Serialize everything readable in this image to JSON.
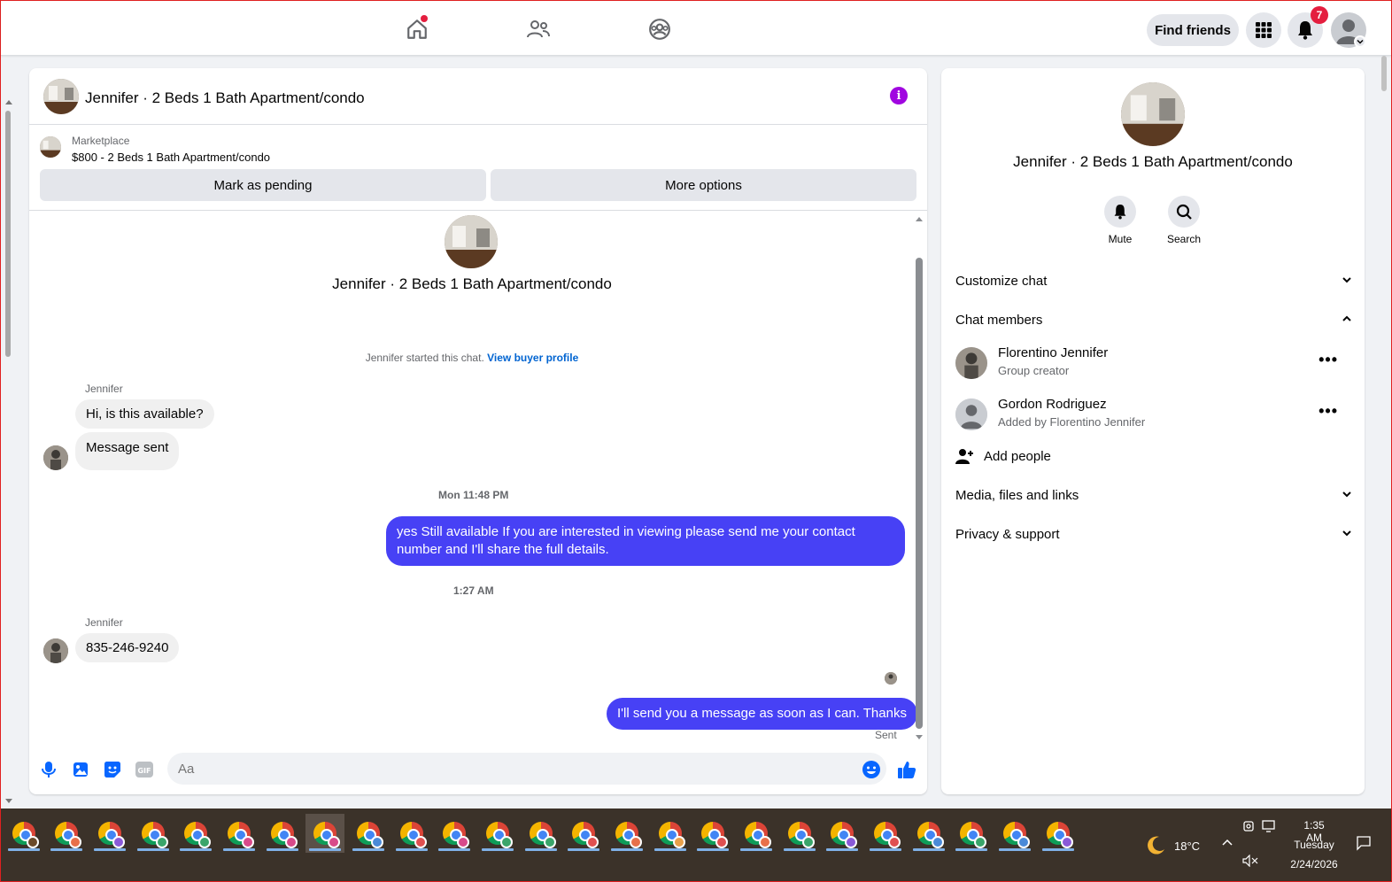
{
  "topnav": {
    "find_friends": "Find friends",
    "notifications_count": "7"
  },
  "chat": {
    "title": "Jennifer · 2 Beds 1 Bath Apartment/condo",
    "marketplace_label": "Marketplace",
    "listing": "$800 - 2 Beds 1 Bath Apartment/condo",
    "mark_pending": "Mark as pending",
    "more_options": "More options",
    "intro_title": "Jennifer · 2 Beds 1 Bath Apartment/condo",
    "started_text": "Jennifer started this chat.",
    "view_buyer_profile": "View buyer profile",
    "messages": [
      {
        "sender": "Jennifer",
        "text": "Hi, is this available?"
      },
      {
        "text": "Message sent"
      },
      {
        "timestamp": "Mon 11:48 PM"
      },
      {
        "text": "yes Still available If you are interested in viewing please send me your contact number and I'll share the full details."
      },
      {
        "timestamp": "1:27 AM"
      },
      {
        "sender": "Jennifer",
        "text": "835-246-9240"
      },
      {
        "text": "I'll send you a message as soon as I can. Thanks"
      }
    ],
    "sent_status": "Sent",
    "composer_placeholder": "Aa"
  },
  "right_panel": {
    "title": "Jennifer · 2 Beds 1 Bath Apartment/condo",
    "mute": "Mute",
    "search": "Search",
    "customize_chat": "Customize chat",
    "chat_members": "Chat members",
    "members": [
      {
        "name": "Florentino Jennifer",
        "sub": "Group creator"
      },
      {
        "name": "Gordon Rodriguez",
        "sub": "Added by Florentino Jennifer"
      }
    ],
    "add_people": "Add people",
    "media_files_links": "Media, files and links",
    "privacy_support": "Privacy & support"
  },
  "taskbar": {
    "temperature": "18°C",
    "time": "1:35 AM",
    "day": "Tuesday",
    "date": "2/24/2026"
  },
  "colors": {
    "accent": "#4741f5",
    "badge": "#e41e3f",
    "info": "#a006e0",
    "link": "#0064d1"
  }
}
